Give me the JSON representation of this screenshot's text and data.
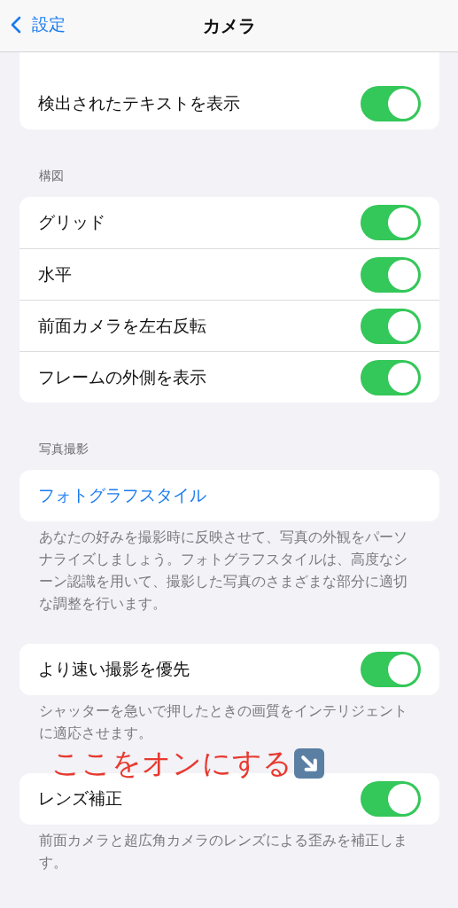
{
  "nav": {
    "back": "設定",
    "title": "カメラ"
  },
  "sections": [
    {
      "rows": [
        {
          "kind": "toggle",
          "label": "検出されたテキストを表示",
          "on": true
        }
      ]
    },
    {
      "header": "構図",
      "rows": [
        {
          "kind": "toggle",
          "label": "グリッド",
          "on": true
        },
        {
          "kind": "toggle",
          "label": "水平",
          "on": true
        },
        {
          "kind": "toggle",
          "label": "前面カメラを左右反転",
          "on": true
        },
        {
          "kind": "toggle",
          "label": "フレームの外側を表示",
          "on": true
        }
      ]
    },
    {
      "header": "写真撮影",
      "rows": [
        {
          "kind": "link",
          "label": "フォトグラフスタイル"
        }
      ],
      "footer": "あなたの好みを撮影時に反映させて、写真の外観をパーソナライズしましょう。フォトグラフスタイルは、高度なシーン認識を用いて、撮影した写真のさまざまな部分に適切な調整を行います。"
    },
    {
      "rows": [
        {
          "kind": "toggle",
          "label": "より速い撮影を優先",
          "on": true
        }
      ],
      "footer": "シャッターを急いで押したときの画質をインテリジェントに適応させます。"
    },
    {
      "annotation": "ここをオンにする",
      "rows": [
        {
          "kind": "toggle",
          "label": "レンズ補正",
          "on": true
        }
      ],
      "footer": "前面カメラと超広角カメラのレンズによる歪みを補正します。"
    }
  ]
}
